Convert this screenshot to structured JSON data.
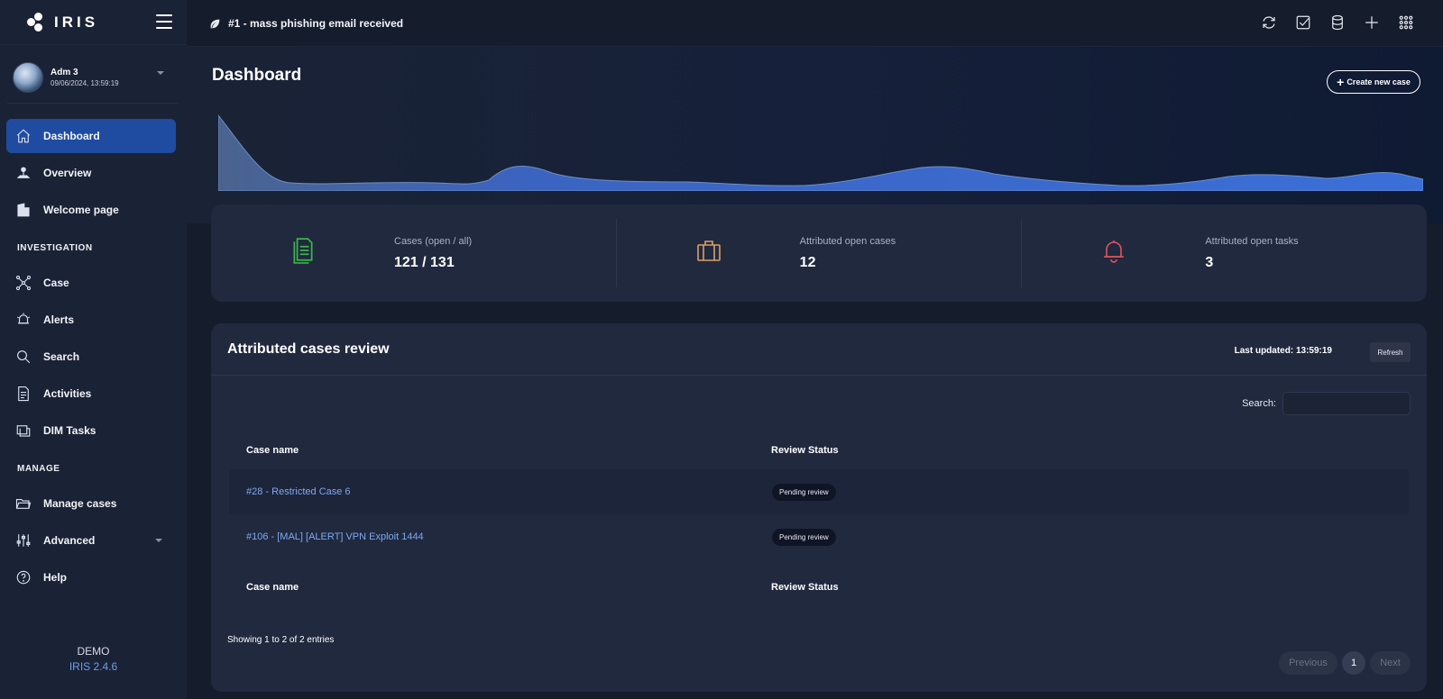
{
  "app": {
    "logo_text": "IRIS"
  },
  "topbar": {
    "case_title": "#1 - mass phishing email received",
    "icons": [
      "refresh-icon",
      "checklist-icon",
      "database-icon",
      "plus-icon",
      "grid-icon"
    ]
  },
  "user": {
    "name": "Adm 3",
    "datetime": "09/06/2024, 13:59:19"
  },
  "sidebar": {
    "items": [
      {
        "label": "Dashboard",
        "icon": "home-icon",
        "active": true
      },
      {
        "label": "Overview",
        "icon": "overview-icon"
      },
      {
        "label": "Welcome page",
        "icon": "building-icon"
      }
    ],
    "investigation_title": "INVESTIGATION",
    "investigation_items": [
      {
        "label": "Case",
        "icon": "network-icon"
      },
      {
        "label": "Alerts",
        "icon": "bell-icon"
      },
      {
        "label": "Search",
        "icon": "search-icon"
      },
      {
        "label": "Activities",
        "icon": "document-icon"
      },
      {
        "label": "DIM Tasks",
        "icon": "tasks-icon"
      }
    ],
    "manage_title": "MANAGE",
    "manage_items": [
      {
        "label": "Manage cases",
        "icon": "folder-icon"
      },
      {
        "label": "Advanced",
        "icon": "sliders-icon"
      },
      {
        "label": "Help",
        "icon": "help-icon"
      }
    ],
    "footer_demo": "DEMO",
    "footer_version": "IRIS 2.4.6"
  },
  "header": {
    "title": "Dashboard",
    "create_button": "Create new case",
    "trend_color": "#3b6fd8"
  },
  "stats": [
    {
      "label": "Cases (open / all)",
      "value": "121 / 131",
      "icon": "file-icon",
      "color": "#3cb54a"
    },
    {
      "label": "Attributed open cases",
      "value": "12",
      "icon": "briefcase-icon",
      "color": "#d9a066"
    },
    {
      "label": "Attributed open tasks",
      "value": "3",
      "icon": "bell-icon",
      "color": "#e0555e"
    }
  ],
  "review": {
    "title": "Attributed cases review",
    "last_updated": "Last updated: 13:59:19",
    "refresh_label": "Refresh",
    "search_label": "Search:",
    "columns": [
      "Case name",
      "Review Status"
    ],
    "rows": [
      {
        "case": "#28 - Restricted Case 6",
        "status": "Pending review"
      },
      {
        "case": "#106 - [MAL] [ALERT] VPN Exploit 1444",
        "status": "Pending review"
      }
    ],
    "showing": "Showing 1 to 2 of 2 entries",
    "pager": {
      "prev": "Previous",
      "page": "1",
      "next": "Next"
    }
  }
}
